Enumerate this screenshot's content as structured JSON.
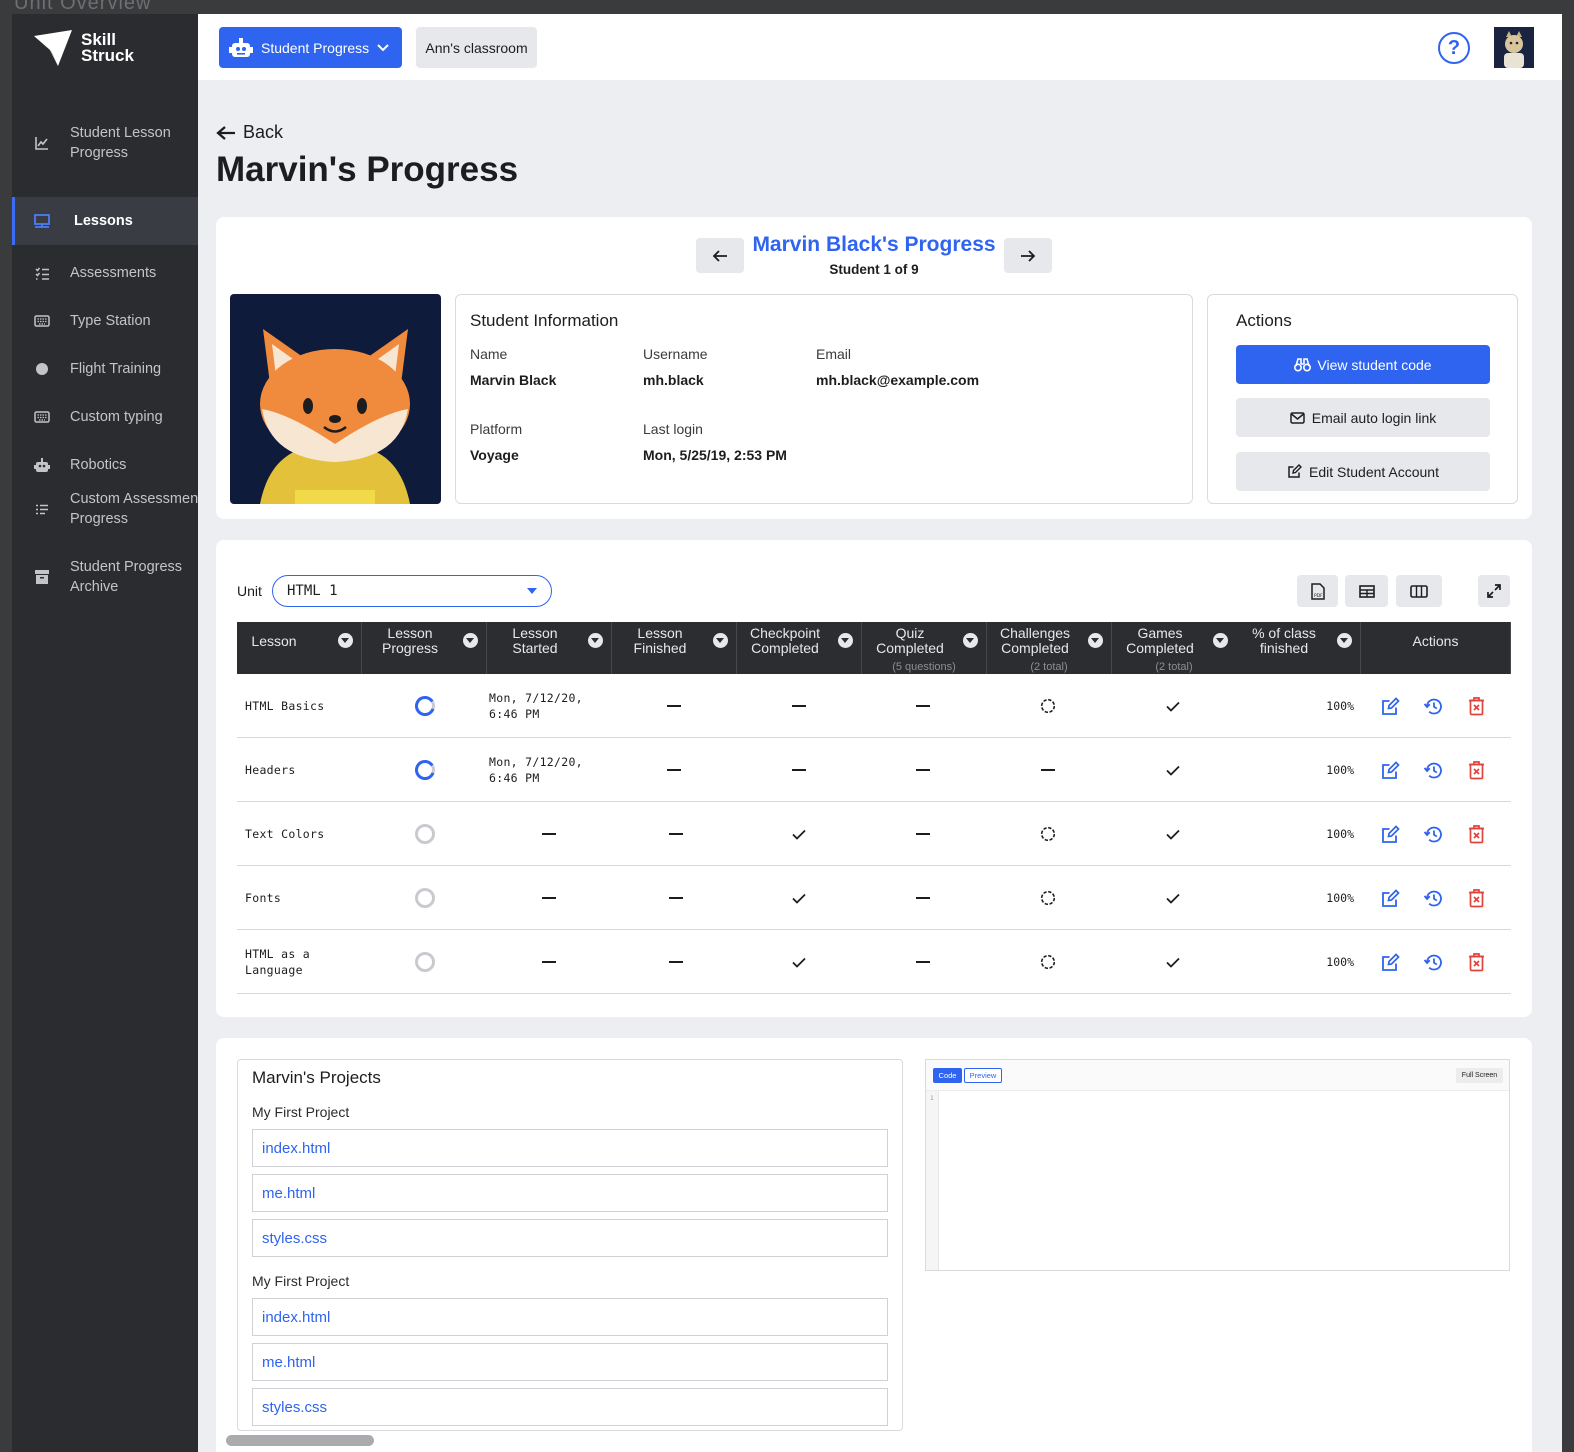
{
  "window": {
    "topbar_text": "Unit   Overview"
  },
  "brand": {
    "line1": "Skill",
    "line2": "Struck"
  },
  "sidebar": {
    "items": [
      {
        "label": "Student Lesson Progress",
        "icon": "chart-line-icon"
      },
      {
        "label": "Lessons",
        "icon": "presentation-board-icon"
      },
      {
        "label": "Assessments",
        "icon": "list-check-icon"
      },
      {
        "label": "Type Station",
        "icon": "keyboard-icon"
      },
      {
        "label": "Flight Training",
        "icon": "circle-icon"
      },
      {
        "label": "Custom typing",
        "icon": "keyboard-icon"
      },
      {
        "label": "Robotics",
        "icon": "robot-icon"
      },
      {
        "label": "Custom Assessment Progress",
        "icon": "list-icon"
      },
      {
        "label": "Student Progress Archive",
        "icon": "archive-icon"
      }
    ]
  },
  "header": {
    "nav_button": "Student Progress",
    "classroom": "Ann's classroom",
    "help_icon": "help-icon"
  },
  "page": {
    "back": "Back",
    "title": "Marvin's Progress"
  },
  "student_nav": {
    "title": "Marvin Black's Progress",
    "counter": "Student 1 of 9"
  },
  "student_info": {
    "heading": "Student Information",
    "name_label": "Name",
    "name": "Marvin Black",
    "username_label": "Username",
    "username": "mh.black",
    "email_label": "Email",
    "email": "mh.black@example.com",
    "platform_label": "Platform",
    "platform": "Voyage",
    "last_login_label": "Last login",
    "last_login": "Mon, 5/25/19, 2:53 PM"
  },
  "actions": {
    "heading": "Actions",
    "view_code": "View student code",
    "email_link": "Email auto login link",
    "edit_account": "Edit Student Account"
  },
  "unit": {
    "label": "Unit",
    "selected": "HTML 1"
  },
  "table": {
    "headers": [
      {
        "l1": "Lesson",
        "l2": "",
        "sub": ""
      },
      {
        "l1": "Lesson",
        "l2": "Progress",
        "sub": ""
      },
      {
        "l1": "Lesson",
        "l2": "Started",
        "sub": ""
      },
      {
        "l1": "Lesson",
        "l2": "Finished",
        "sub": ""
      },
      {
        "l1": "Checkpoint",
        "l2": "Completed",
        "sub": ""
      },
      {
        "l1": "Quiz",
        "l2": "Completed",
        "sub": "(5 questions)"
      },
      {
        "l1": "Challenges",
        "l2": "Completed",
        "sub": "(2 total)"
      },
      {
        "l1": "Games",
        "l2": "Completed",
        "sub": "(2 total)"
      },
      {
        "l1": "% of class",
        "l2": "finished",
        "sub": ""
      },
      {
        "l1": "Actions",
        "l2": "",
        "sub": ""
      }
    ],
    "rows": [
      {
        "lesson": "HTML Basics",
        "progress": 0.85,
        "started": "Mon, 7/12/20,\n6:46 PM",
        "finished": "dash",
        "checkpoint": "dash",
        "quiz": "dash",
        "challenges": "partial",
        "games": "check",
        "pct": "100%"
      },
      {
        "lesson": "Headers",
        "progress": 0.85,
        "started": "Mon, 7/12/20,\n6:46 PM",
        "finished": "dash",
        "checkpoint": "dash",
        "quiz": "dash",
        "challenges": "dash",
        "games": "check",
        "pct": "100%"
      },
      {
        "lesson": "Text Colors",
        "progress": 0,
        "started": "dash",
        "finished": "dash",
        "checkpoint": "check",
        "quiz": "dash",
        "challenges": "partial",
        "games": "check",
        "pct": "100%"
      },
      {
        "lesson": "Fonts",
        "progress": 0,
        "started": "dash",
        "finished": "dash",
        "checkpoint": "check",
        "quiz": "dash",
        "challenges": "partial",
        "games": "check",
        "pct": "100%"
      },
      {
        "lesson": "HTML as a\nLanguage",
        "progress": 0,
        "started": "dash",
        "finished": "dash",
        "checkpoint": "check",
        "quiz": "dash",
        "challenges": "partial",
        "games": "check",
        "pct": "100%"
      }
    ]
  },
  "projects": {
    "heading": "Marvin's Projects",
    "groups": [
      {
        "name": "My First Project",
        "files": [
          "index.html",
          "me.html",
          "styles.css"
        ]
      },
      {
        "name": "My First Project",
        "files": [
          "index.html",
          "me.html",
          "styles.css"
        ]
      }
    ]
  },
  "editor": {
    "code_tab": "Code",
    "preview_tab": "Preview",
    "fullscreen": "Full Screen",
    "line_number": "1"
  },
  "colors": {
    "accent": "#2f64f0",
    "sidebar": "#2b2c2f",
    "danger": "#e0453d"
  }
}
